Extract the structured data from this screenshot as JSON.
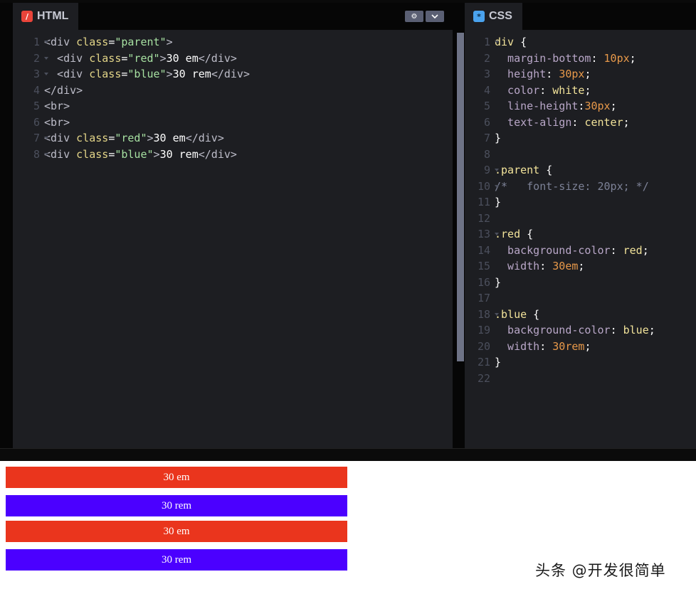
{
  "html_pane": {
    "tab_label": "HTML",
    "icon": "html-slash-icon",
    "settings_icon": "gear-icon",
    "menu_icon": "chevron-down-icon",
    "lines": [
      {
        "n": "1",
        "fold": true,
        "tokens": [
          {
            "t": "<div ",
            "c": "tag"
          },
          {
            "t": "class",
            "c": "attr"
          },
          {
            "t": "=",
            "c": "plain"
          },
          {
            "t": "\"parent\"",
            "c": "str"
          },
          {
            "t": ">",
            "c": "tag"
          }
        ]
      },
      {
        "n": "2",
        "fold": true,
        "tokens": [
          {
            "t": "  <div ",
            "c": "tag"
          },
          {
            "t": "class",
            "c": "attr"
          },
          {
            "t": "=",
            "c": "plain"
          },
          {
            "t": "\"red\"",
            "c": "str"
          },
          {
            "t": ">",
            "c": "tag"
          },
          {
            "t": "30 em",
            "c": "plain"
          },
          {
            "t": "</div>",
            "c": "tag"
          }
        ]
      },
      {
        "n": "3",
        "fold": true,
        "tokens": [
          {
            "t": "  <div ",
            "c": "tag"
          },
          {
            "t": "class",
            "c": "attr"
          },
          {
            "t": "=",
            "c": "plain"
          },
          {
            "t": "\"blue\"",
            "c": "str"
          },
          {
            "t": ">",
            "c": "tag"
          },
          {
            "t": "30 rem",
            "c": "plain"
          },
          {
            "t": "</div>",
            "c": "tag"
          }
        ]
      },
      {
        "n": "4",
        "fold": false,
        "tokens": [
          {
            "t": "</div>",
            "c": "tag"
          }
        ]
      },
      {
        "n": "5",
        "fold": false,
        "tokens": [
          {
            "t": "<br>",
            "c": "tag"
          }
        ]
      },
      {
        "n": "6",
        "fold": false,
        "tokens": [
          {
            "t": "<br>",
            "c": "tag"
          }
        ]
      },
      {
        "n": "7",
        "fold": true,
        "tokens": [
          {
            "t": "<div ",
            "c": "tag"
          },
          {
            "t": "class",
            "c": "attr"
          },
          {
            "t": "=",
            "c": "plain"
          },
          {
            "t": "\"red\"",
            "c": "str"
          },
          {
            "t": ">",
            "c": "tag"
          },
          {
            "t": "30 em",
            "c": "plain"
          },
          {
            "t": "</div>",
            "c": "tag"
          }
        ]
      },
      {
        "n": "8",
        "fold": true,
        "tokens": [
          {
            "t": "<div ",
            "c": "tag"
          },
          {
            "t": "class",
            "c": "attr"
          },
          {
            "t": "=",
            "c": "plain"
          },
          {
            "t": "\"blue\"",
            "c": "str"
          },
          {
            "t": ">",
            "c": "tag"
          },
          {
            "t": "30 rem",
            "c": "plain"
          },
          {
            "t": "</div>",
            "c": "tag"
          }
        ]
      }
    ]
  },
  "css_pane": {
    "tab_label": "CSS",
    "icon": "css-asterisk-icon",
    "lines": [
      {
        "n": "1",
        "fold": true,
        "tokens": [
          {
            "t": "div",
            "c": "sel"
          },
          {
            "t": " {",
            "c": "plain"
          }
        ]
      },
      {
        "n": "2",
        "fold": false,
        "tokens": [
          {
            "t": "  margin-bottom",
            "c": "prop"
          },
          {
            "t": ": ",
            "c": "plain"
          },
          {
            "t": "10px",
            "c": "num"
          },
          {
            "t": ";",
            "c": "plain"
          }
        ]
      },
      {
        "n": "3",
        "fold": false,
        "tokens": [
          {
            "t": "  height",
            "c": "prop"
          },
          {
            "t": ": ",
            "c": "plain"
          },
          {
            "t": "30px",
            "c": "num"
          },
          {
            "t": ";",
            "c": "plain"
          }
        ]
      },
      {
        "n": "4",
        "fold": false,
        "tokens": [
          {
            "t": "  color",
            "c": "prop"
          },
          {
            "t": ": ",
            "c": "plain"
          },
          {
            "t": "white",
            "c": "kw"
          },
          {
            "t": ";",
            "c": "plain"
          }
        ]
      },
      {
        "n": "5",
        "fold": false,
        "tokens": [
          {
            "t": "  line-height",
            "c": "prop"
          },
          {
            "t": ":",
            "c": "plain"
          },
          {
            "t": "30px",
            "c": "num"
          },
          {
            "t": ";",
            "c": "plain"
          }
        ]
      },
      {
        "n": "6",
        "fold": false,
        "tokens": [
          {
            "t": "  text-align",
            "c": "prop"
          },
          {
            "t": ": ",
            "c": "plain"
          },
          {
            "t": "center",
            "c": "kw"
          },
          {
            "t": ";",
            "c": "plain"
          }
        ]
      },
      {
        "n": "7",
        "fold": false,
        "tokens": [
          {
            "t": "}",
            "c": "plain"
          }
        ]
      },
      {
        "n": "8",
        "fold": false,
        "tokens": []
      },
      {
        "n": "9",
        "fold": true,
        "tokens": [
          {
            "t": ".parent",
            "c": "sel"
          },
          {
            "t": " {",
            "c": "plain"
          }
        ]
      },
      {
        "n": "10",
        "fold": true,
        "tokens": [
          {
            "t": "/*   font-size: 20px; */",
            "c": "com"
          }
        ]
      },
      {
        "n": "11",
        "fold": false,
        "tokens": [
          {
            "t": "}",
            "c": "plain"
          }
        ]
      },
      {
        "n": "12",
        "fold": false,
        "tokens": []
      },
      {
        "n": "13",
        "fold": true,
        "tokens": [
          {
            "t": ".red",
            "c": "sel"
          },
          {
            "t": " {",
            "c": "plain"
          }
        ]
      },
      {
        "n": "14",
        "fold": false,
        "tokens": [
          {
            "t": "  background-color",
            "c": "prop"
          },
          {
            "t": ": ",
            "c": "plain"
          },
          {
            "t": "red",
            "c": "kw"
          },
          {
            "t": ";",
            "c": "plain"
          }
        ]
      },
      {
        "n": "15",
        "fold": false,
        "tokens": [
          {
            "t": "  width",
            "c": "prop"
          },
          {
            "t": ": ",
            "c": "plain"
          },
          {
            "t": "30em",
            "c": "num"
          },
          {
            "t": ";",
            "c": "plain"
          }
        ]
      },
      {
        "n": "16",
        "fold": false,
        "tokens": [
          {
            "t": "}",
            "c": "plain"
          }
        ]
      },
      {
        "n": "17",
        "fold": false,
        "tokens": []
      },
      {
        "n": "18",
        "fold": true,
        "tokens": [
          {
            "t": ".blue",
            "c": "sel"
          },
          {
            "t": " {",
            "c": "plain"
          }
        ]
      },
      {
        "n": "19",
        "fold": false,
        "tokens": [
          {
            "t": "  background-color",
            "c": "prop"
          },
          {
            "t": ": ",
            "c": "plain"
          },
          {
            "t": "blue",
            "c": "kw"
          },
          {
            "t": ";",
            "c": "plain"
          }
        ]
      },
      {
        "n": "20",
        "fold": false,
        "tokens": [
          {
            "t": "  width",
            "c": "prop"
          },
          {
            "t": ": ",
            "c": "plain"
          },
          {
            "t": "30rem",
            "c": "num"
          },
          {
            "t": ";",
            "c": "plain"
          }
        ]
      },
      {
        "n": "21",
        "fold": false,
        "tokens": [
          {
            "t": "}",
            "c": "plain"
          }
        ]
      },
      {
        "n": "22",
        "fold": false,
        "tokens": []
      }
    ]
  },
  "preview": {
    "blocks": [
      {
        "label": "30 em",
        "color": "red"
      },
      {
        "label": "30 rem",
        "color": "blue"
      },
      {
        "label": "30 em",
        "color": "red"
      },
      {
        "label": "30 rem",
        "color": "blue"
      }
    ]
  },
  "watermark": "头条 @开发很简单",
  "colors": {
    "editor_bg": "#1d1e22",
    "red_block": "#ea351d",
    "blue_block": "#4b00ff"
  }
}
